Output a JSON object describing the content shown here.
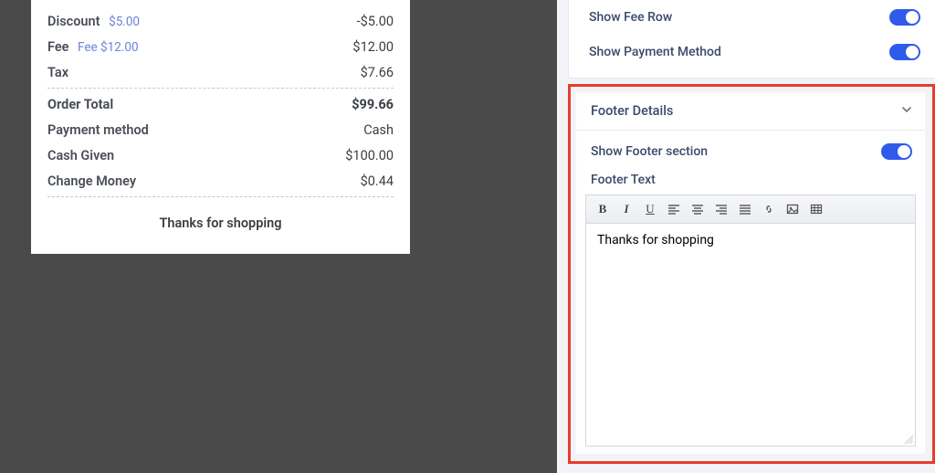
{
  "receipt": {
    "rows": {
      "discount": {
        "label": "Discount",
        "badge": "$5.00",
        "value": "-$5.00"
      },
      "fee": {
        "label": "Fee",
        "badge": "Fee $12.00",
        "value": "$12.00"
      },
      "tax": {
        "label": "Tax",
        "value": "$7.66"
      },
      "order_total": {
        "label": "Order Total",
        "value": "$99.66"
      },
      "payment_method": {
        "label": "Payment method",
        "value": "Cash"
      },
      "cash_given": {
        "label": "Cash Given",
        "value": "$100.00"
      },
      "change_money": {
        "label": "Change Money",
        "value": "$0.44"
      }
    },
    "footer_text": "Thanks for shopping"
  },
  "settings": {
    "show_fee_row": {
      "label": "Show Fee Row",
      "on": true
    },
    "show_payment_method": {
      "label": "Show Payment Method",
      "on": true
    },
    "footer_details": {
      "title": "Footer Details",
      "show_footer_section": {
        "label": "Show Footer section",
        "on": true
      },
      "footer_text_label": "Footer Text",
      "footer_text_value": "Thanks for shopping"
    }
  }
}
